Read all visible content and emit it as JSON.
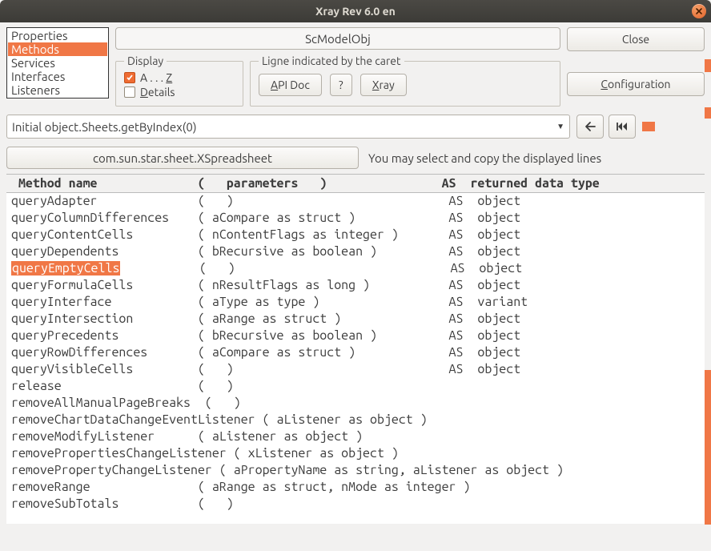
{
  "window": {
    "title": "Xray    Rev 6.0 en"
  },
  "sidebar": {
    "items": [
      {
        "label": "Properties"
      },
      {
        "label": "Methods"
      },
      {
        "label": "Services"
      },
      {
        "label": "Interfaces"
      },
      {
        "label": "Listeners"
      }
    ],
    "selected_index": 1
  },
  "object_title": "ScModelObj",
  "close_label": "Close",
  "configuration_label": "Configuration",
  "display_group": {
    "legend": "Display",
    "az_label_pre": "A . . . ",
    "az_label_u": "Z",
    "az_checked": true,
    "details_label_u": "D",
    "details_label_rest": "etails",
    "details_checked": false
  },
  "caret_group": {
    "legend": "Ligne indicated by the caret",
    "apidoc_u": "A",
    "apidoc_rest": "PI Doc",
    "question": "?",
    "xray_u": "X",
    "xray_rest": "ray"
  },
  "path_value": "Initial object.Sheets.getByIndex(0)",
  "interface_value": "com.sun.star.sheet.XSpreadsheet",
  "hint_text": "You may select and copy the displayed lines",
  "table": {
    "header": " Method name              (   parameters   )                AS  returned data type",
    "rows": [
      {
        "name": "queryAdapter",
        "params": "(   )",
        "ret": "AS  object"
      },
      {
        "name": "queryColumnDifferences",
        "params": "( aCompare as struct )",
        "ret": "AS  object"
      },
      {
        "name": "queryContentCells",
        "params": "( nContentFlags as integer )",
        "ret": "AS  object"
      },
      {
        "name": "queryDependents",
        "params": "( bRecursive as boolean )",
        "ret": "AS  object"
      },
      {
        "name": "queryEmptyCells",
        "params": "(   )",
        "ret": "AS  object",
        "selected": true
      },
      {
        "name": "queryFormulaCells",
        "params": "( nResultFlags as long )",
        "ret": "AS  object"
      },
      {
        "name": "queryInterface",
        "params": "( aType as type )",
        "ret": "AS  variant"
      },
      {
        "name": "queryIntersection",
        "params": "( aRange as struct )",
        "ret": "AS  object"
      },
      {
        "name": "queryPrecedents",
        "params": "( bRecursive as boolean )",
        "ret": "AS  object"
      },
      {
        "name": "queryRowDifferences",
        "params": "( aCompare as struct )",
        "ret": "AS  object"
      },
      {
        "name": "queryVisibleCells",
        "params": "(   )",
        "ret": "AS  object"
      },
      {
        "name": "release",
        "params": "(   )",
        "ret": ""
      },
      {
        "name": "removeAllManualPageBreaks",
        "params": "(   )",
        "ret": "",
        "name_width_override": 26
      },
      {
        "name": "removeChartDataChangeEventListener ( aListener as object )",
        "raw": true
      },
      {
        "name": "removeModifyListener",
        "params": "( aListener as object )",
        "ret": ""
      },
      {
        "name": "removePropertiesChangeListener ( xListener as object )",
        "raw": true
      },
      {
        "name": "removePropertyChangeListener ( aPropertyName as string, aListener as object )",
        "raw": true
      },
      {
        "name": "removeRange",
        "params": "( aRange as struct, nMode as integer )",
        "ret": ""
      },
      {
        "name": "removeSubTotals",
        "params": "(   )",
        "ret": ""
      }
    ]
  }
}
